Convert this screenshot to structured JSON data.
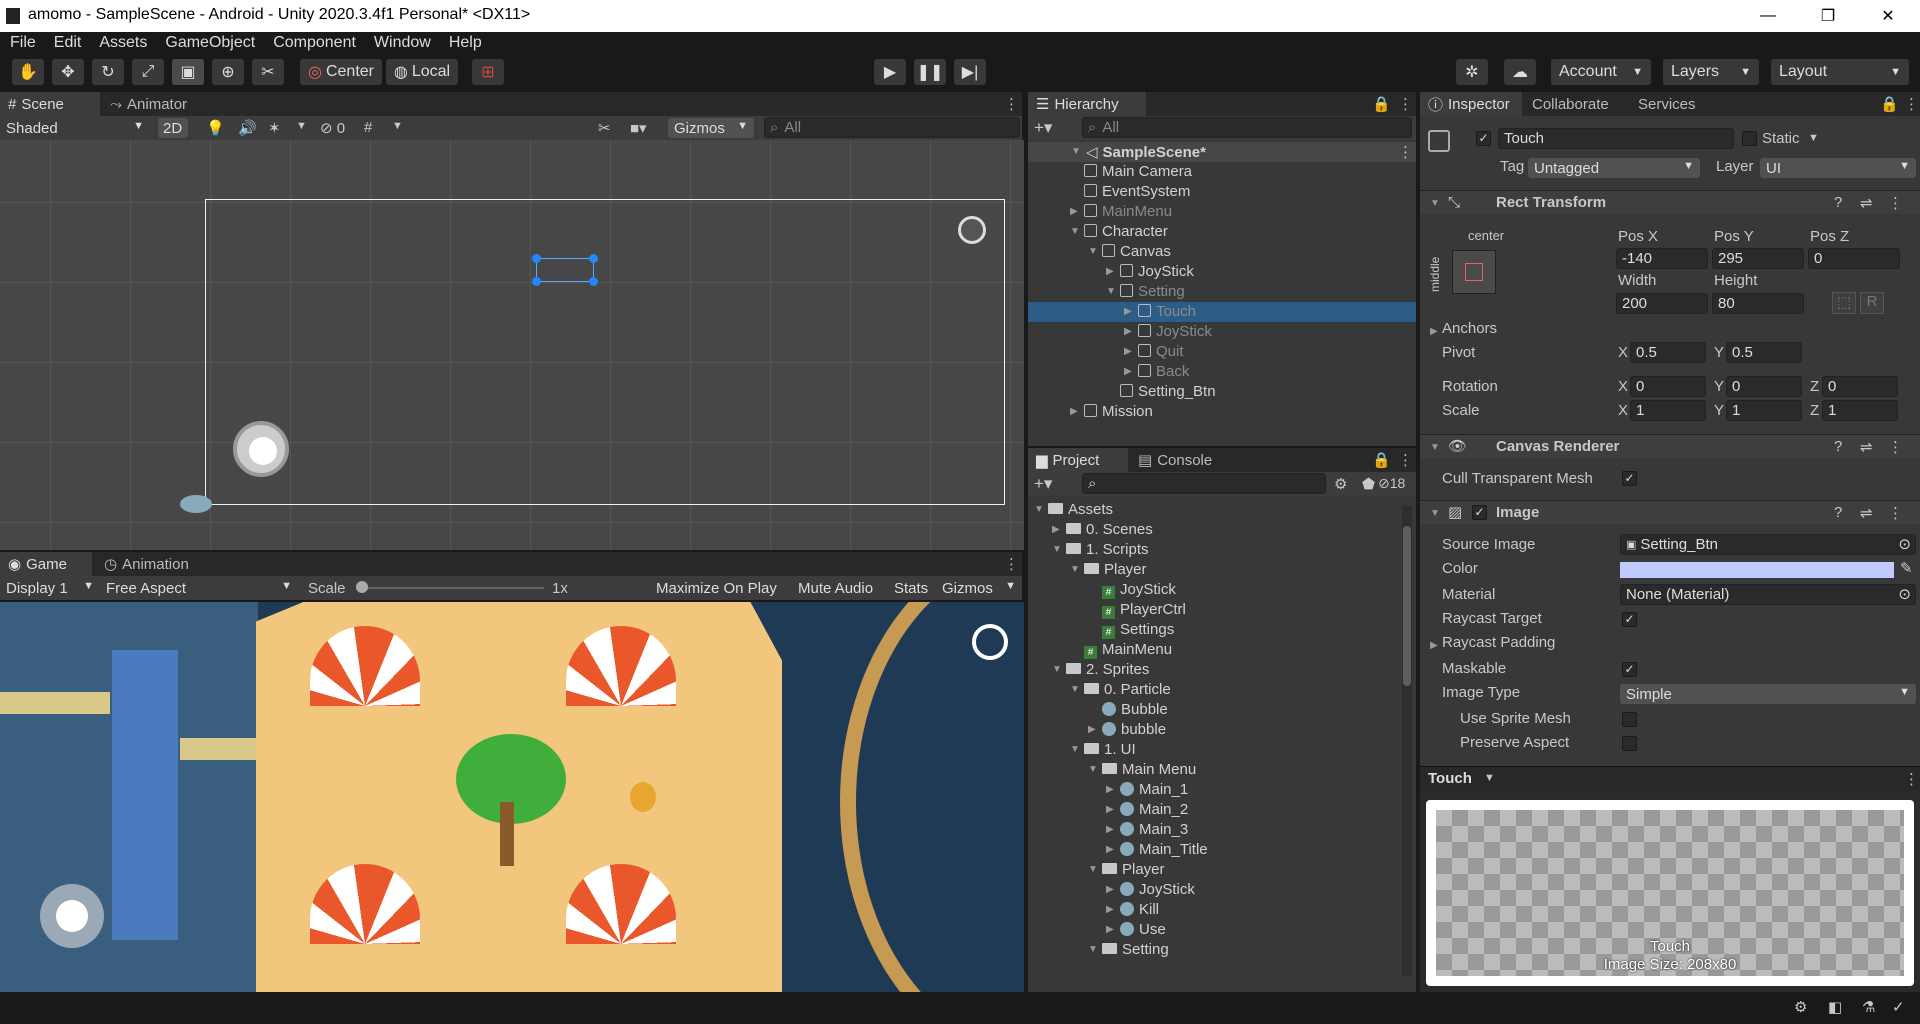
{
  "window": {
    "title": "amomo - SampleScene - Android - Unity 2020.3.4f1 Personal* <DX11>",
    "min": "—",
    "max": "❐",
    "close": "✕"
  },
  "menu": [
    "File",
    "Edit",
    "Assets",
    "GameObject",
    "Component",
    "Window",
    "Help"
  ],
  "toolbar": {
    "pivot": "Center",
    "space": "Local",
    "account": "Account",
    "layers": "Layers",
    "layout": "Layout"
  },
  "scene": {
    "tabs": [
      "Scene",
      "Animator"
    ],
    "shading": "Shaded",
    "mode2d": "2D",
    "hidden_count": "0",
    "gizmos": "Gizmos",
    "search_placeholder": "All"
  },
  "game": {
    "tabs": [
      "Game",
      "Animation"
    ],
    "display": "Display 1",
    "aspect": "Free Aspect",
    "scale_label": "Scale",
    "scale_value": "1x",
    "maximize": "Maximize On Play",
    "mute": "Mute Audio",
    "stats": "Stats",
    "gizmos": "Gizmos"
  },
  "hierarchy": {
    "tab": "Hierarchy",
    "search_placeholder": "All",
    "scene": "SampleScene*",
    "items": [
      {
        "label": "Main Camera",
        "indent": 1,
        "arrow": "",
        "dim": false
      },
      {
        "label": "EventSystem",
        "indent": 1,
        "arrow": "",
        "dim": false
      },
      {
        "label": "MainMenu",
        "indent": 1,
        "arrow": "▶",
        "dim": true
      },
      {
        "label": "Character",
        "indent": 1,
        "arrow": "▼",
        "dim": false
      },
      {
        "label": "Canvas",
        "indent": 2,
        "arrow": "▼",
        "dim": false
      },
      {
        "label": "JoyStick",
        "indent": 3,
        "arrow": "▶",
        "dim": false
      },
      {
        "label": "Setting",
        "indent": 3,
        "arrow": "▼",
        "dim": true
      },
      {
        "label": "Touch",
        "indent": 4,
        "arrow": "▶",
        "dim": true,
        "selected": true
      },
      {
        "label": "JoyStick",
        "indent": 4,
        "arrow": "▶",
        "dim": true
      },
      {
        "label": "Quit",
        "indent": 4,
        "arrow": "▶",
        "dim": true
      },
      {
        "label": "Back",
        "indent": 4,
        "arrow": "▶",
        "dim": true
      },
      {
        "label": "Setting_Btn",
        "indent": 3,
        "arrow": "",
        "dim": false
      },
      {
        "label": "Mission",
        "indent": 1,
        "arrow": "▶",
        "dim": false
      }
    ]
  },
  "project": {
    "tabs": [
      "Project",
      "Console"
    ],
    "hidden_count": "18",
    "items": [
      {
        "label": "Assets",
        "indent": 0,
        "arrow": "▼",
        "icon": "folder"
      },
      {
        "label": "0. Scenes",
        "indent": 1,
        "arrow": "▶",
        "icon": "folder"
      },
      {
        "label": "1. Scripts",
        "indent": 1,
        "arrow": "▼",
        "icon": "folder"
      },
      {
        "label": "Player",
        "indent": 2,
        "arrow": "▼",
        "icon": "folder"
      },
      {
        "label": "JoyStick",
        "indent": 3,
        "arrow": "",
        "icon": "script"
      },
      {
        "label": "PlayerCtrl",
        "indent": 3,
        "arrow": "",
        "icon": "script"
      },
      {
        "label": "Settings",
        "indent": 3,
        "arrow": "",
        "icon": "script"
      },
      {
        "label": "MainMenu",
        "indent": 2,
        "arrow": "",
        "icon": "script"
      },
      {
        "label": "2. Sprites",
        "indent": 1,
        "arrow": "▼",
        "icon": "folder"
      },
      {
        "label": "0. Particle",
        "indent": 2,
        "arrow": "▼",
        "icon": "folder"
      },
      {
        "label": "Bubble",
        "indent": 3,
        "arrow": "",
        "icon": "sprite"
      },
      {
        "label": "bubble",
        "indent": 3,
        "arrow": "▶",
        "icon": "sprite"
      },
      {
        "label": "1. UI",
        "indent": 2,
        "arrow": "▼",
        "icon": "folder"
      },
      {
        "label": "Main Menu",
        "indent": 3,
        "arrow": "▼",
        "icon": "folder"
      },
      {
        "label": "Main_1",
        "indent": 4,
        "arrow": "▶",
        "icon": "sprite"
      },
      {
        "label": "Main_2",
        "indent": 4,
        "arrow": "▶",
        "icon": "sprite"
      },
      {
        "label": "Main_3",
        "indent": 4,
        "arrow": "▶",
        "icon": "sprite"
      },
      {
        "label": "Main_Title",
        "indent": 4,
        "arrow": "▶",
        "icon": "sprite"
      },
      {
        "label": "Player",
        "indent": 3,
        "arrow": "▼",
        "icon": "folder"
      },
      {
        "label": "JoyStick",
        "indent": 4,
        "arrow": "▶",
        "icon": "sprite"
      },
      {
        "label": "Kill",
        "indent": 4,
        "arrow": "▶",
        "icon": "sprite"
      },
      {
        "label": "Use",
        "indent": 4,
        "arrow": "▶",
        "icon": "sprite"
      },
      {
        "label": "Setting",
        "indent": 3,
        "arrow": "▼",
        "icon": "folder"
      }
    ]
  },
  "inspector": {
    "tabs": [
      "Inspector",
      "Collaborate",
      "Services"
    ],
    "object_name": "Touch",
    "static": "Static",
    "tag_label": "Tag",
    "tag": "Untagged",
    "layer_label": "Layer",
    "layer": "UI",
    "rect": {
      "title": "Rect Transform",
      "anchor_h": "center",
      "anchor_v": "middle",
      "posx_label": "Pos X",
      "posy_label": "Pos Y",
      "posz_label": "Pos Z",
      "posx": "-140",
      "posy": "295",
      "posz": "0",
      "width_label": "Width",
      "height_label": "Height",
      "width": "200",
      "height": "80",
      "r_button": "R",
      "anchors": "Anchors",
      "pivot": "Pivot",
      "pivot_x": "0.5",
      "pivot_y": "0.5",
      "rotation": "Rotation",
      "rot_x": "0",
      "rot_y": "0",
      "rot_z": "0",
      "scale": "Scale",
      "scale_x": "1",
      "scale_y": "1",
      "scale_z": "1",
      "x": "X",
      "y": "Y",
      "z": "Z"
    },
    "canvas_renderer": {
      "title": "Canvas Renderer",
      "cull": "Cull Transparent Mesh"
    },
    "image": {
      "title": "Image",
      "source_label": "Source Image",
      "source": "Setting_Btn",
      "color_label": "Color",
      "color": "#c0caff",
      "material_label": "Material",
      "material": "None (Material)",
      "raycast_target": "Raycast Target",
      "raycast_padding": "Raycast Padding",
      "maskable": "Maskable",
      "image_type_label": "Image Type",
      "image_type": "Simple",
      "use_sprite_mesh": "Use Sprite Mesh",
      "preserve_aspect": "Preserve Aspect"
    },
    "preview": {
      "name": "Touch",
      "caption_name": "Touch",
      "caption_size": "Image Size: 208x80"
    }
  }
}
